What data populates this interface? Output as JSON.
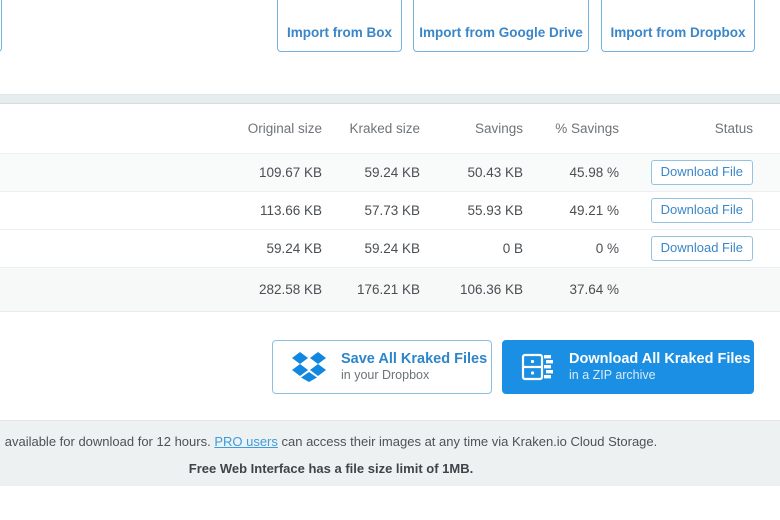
{
  "import_bar": {
    "buttons": [
      {
        "label": "Import from Box",
        "name": "import-from-box-button"
      },
      {
        "label": "Import from Google Drive",
        "name": "import-from-google-drive-button"
      },
      {
        "label": "Import from Dropbox",
        "name": "import-from-dropbox-button"
      }
    ]
  },
  "table": {
    "headers": {
      "file": "",
      "original_size": "Original size",
      "kraked_size": "Kraked size",
      "savings": "Savings",
      "percent_savings": "% Savings",
      "status": "Status"
    },
    "rows": [
      {
        "original_size": "109.67 KB",
        "kraked_size": "59.24 KB",
        "savings": "50.43 KB",
        "percent_savings": "45.98 %",
        "status_label": "Download File"
      },
      {
        "original_size": "113.66 KB",
        "kraked_size": "57.73 KB",
        "savings": "55.93 KB",
        "percent_savings": "49.21 %",
        "status_label": "Download File"
      },
      {
        "original_size": "59.24 KB",
        "kraked_size": "59.24 KB",
        "savings": "0 B",
        "percent_savings": "0 %",
        "status_label": "Download File"
      }
    ],
    "totals": {
      "original_size": "282.58 KB",
      "kraked_size": "176.21 KB",
      "savings": "106.36 KB",
      "percent_savings": "37.64 %",
      "status_label": ""
    }
  },
  "actions": {
    "save_dropbox": {
      "title": "Save All Kraked Files",
      "subtitle": "in your Dropbox",
      "icon": "dropbox-icon"
    },
    "download_zip": {
      "title": "Download All Kraked Files",
      "subtitle": "in a ZIP archive",
      "icon": "zip-archive-icon"
    }
  },
  "footer": {
    "line1_before": "available for download for 12 hours. ",
    "line1_link": "PRO users",
    "line1_after": " can access their images at any time via Kraken.io Cloud Storage.",
    "line2": "Free Web Interface has a file size limit of 1MB."
  },
  "colors": {
    "accent_blue": "#3a86c8",
    "primary_button": "#1a8fe3",
    "dropbox_blue": "#0f82e2",
    "band_gray": "#e7ecee",
    "footer_gray": "#eef1f2"
  }
}
